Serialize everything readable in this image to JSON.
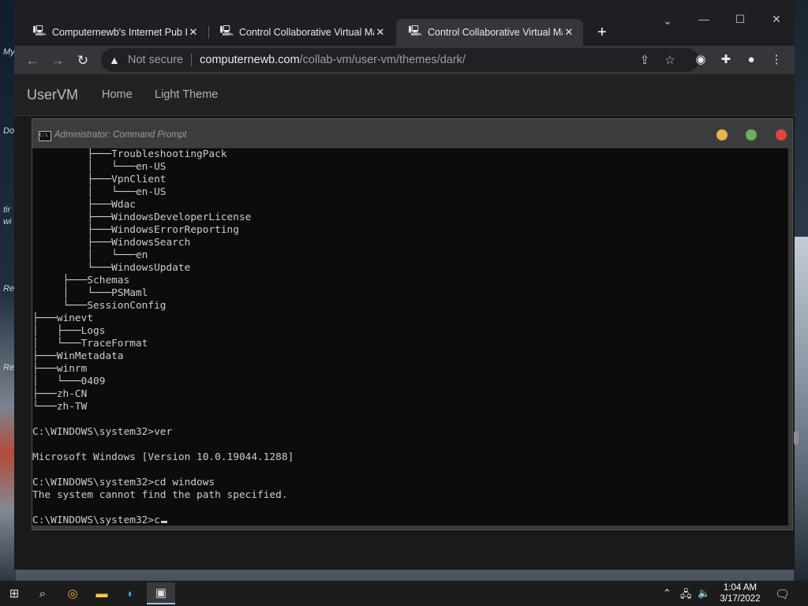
{
  "browser": {
    "tabs": [
      {
        "title": "Computernewb's Internet Pub Hub"
      },
      {
        "title": "Control Collaborative Virtual Machine"
      },
      {
        "title": "Control Collaborative Virtual Machine"
      }
    ],
    "new_tab": "+",
    "security_label": "Not secure",
    "url_host": "computernewb.com",
    "url_path": "/collab-vm/user-vm/themes/dark/"
  },
  "site": {
    "brand": "UserVM",
    "nav": [
      "Home",
      "Light Theme"
    ]
  },
  "vm_window": {
    "title": "Administrator: Command Prompt"
  },
  "console_lines": [
    "         ├───TroubleshootingPack",
    "         │   └───en-US",
    "         ├───VpnClient",
    "         │   └───en-US",
    "         ├───Wdac",
    "         ├───WindowsDeveloperLicense",
    "         ├───WindowsErrorReporting",
    "         ├───WindowsSearch",
    "         │   └───en",
    "         └───WindowsUpdate",
    "     ├───Schemas",
    "     │   └───PSMaml",
    "     └───SessionConfig",
    "├───winevt",
    "│   ├───Logs",
    "│   └───TraceFormat",
    "├───WinMetadata",
    "├───winrm",
    "│   └───0409",
    "├───zh-CN",
    "└───zh-TW",
    "",
    "C:\\WINDOWS\\system32>ver",
    "",
    "Microsoft Windows [Version 10.0.19044.1288]",
    "",
    "C:\\WINDOWS\\system32>cd windows",
    "The system cannot find the path specified.",
    "",
    "C:\\WINDOWS\\system32>c"
  ],
  "desktop_labels": [
    "My",
    "Do",
    "N",
    "tir",
    "wi",
    "Re",
    "Re"
  ],
  "taskbar": {
    "time": "1:04 AM",
    "date": "3/17/2022"
  },
  "colors": {
    "close_dot": "#e0443e",
    "minimize_dot": "#e6b84a",
    "maximize_dot": "#6fae5a"
  }
}
